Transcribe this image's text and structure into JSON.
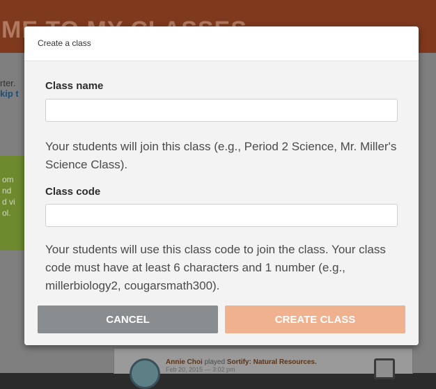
{
  "background": {
    "title": "ME TO MY CLASSES",
    "text_line1": "rter.",
    "text_line2": "kip t",
    "green_lines": [
      "om",
      "nd",
      "d vi",
      "ol."
    ],
    "activity": {
      "name": "Annie Choi",
      "verb": "played",
      "game": "Sortify: Natural Resources.",
      "date": "Feb 20, 2015 — 3:02 pm"
    }
  },
  "modal": {
    "title": "Create a class",
    "class_name": {
      "label": "Class name",
      "value": "",
      "placeholder": "",
      "help": "Your students will join this class (e.g., Period 2 Science, Mr. Miller's Science Class)."
    },
    "class_code": {
      "label": "Class code",
      "value": "",
      "placeholder": "",
      "help": "Your students will use this class code to join the class. Your class code must have at least 6 characters and 1 number (e.g., millerbiology2, cougarsmath300)."
    },
    "buttons": {
      "cancel": "CANCEL",
      "create": "CREATE CLASS"
    }
  },
  "colors": {
    "header_bg": "#c0522a",
    "cancel_bg": "#8a8d8f",
    "create_bg": "#f0b18f",
    "modal_body_bg": "#f3f3f3"
  }
}
